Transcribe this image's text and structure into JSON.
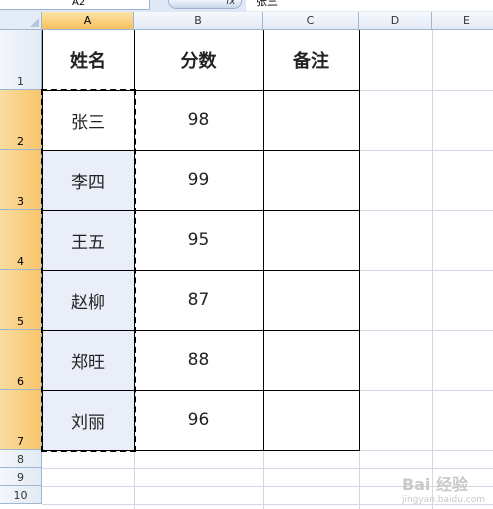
{
  "formula_bar": {
    "name_box": "A2",
    "fx_label": "fx",
    "content": "张三"
  },
  "columns": [
    "A",
    "B",
    "C",
    "D",
    "E"
  ],
  "rows": [
    "1",
    "2",
    "3",
    "4",
    "5",
    "6",
    "7",
    "8",
    "9",
    "10"
  ],
  "table": {
    "headers": [
      "姓名",
      "分数",
      "备注"
    ],
    "records": [
      {
        "name": "张三",
        "score": "98",
        "note": ""
      },
      {
        "name": "李四",
        "score": "99",
        "note": ""
      },
      {
        "name": "王五",
        "score": "95",
        "note": ""
      },
      {
        "name": "赵柳",
        "score": "87",
        "note": ""
      },
      {
        "name": "郑旺",
        "score": "88",
        "note": ""
      },
      {
        "name": "刘丽",
        "score": "96",
        "note": ""
      }
    ]
  },
  "colors": {
    "active_header": "#f7c05c",
    "selection_fill": "#eaeef8",
    "gridline": "#d0d7e5"
  },
  "watermark": {
    "text": "Bai 经验",
    "sub": "jingyan.baidu.com"
  }
}
